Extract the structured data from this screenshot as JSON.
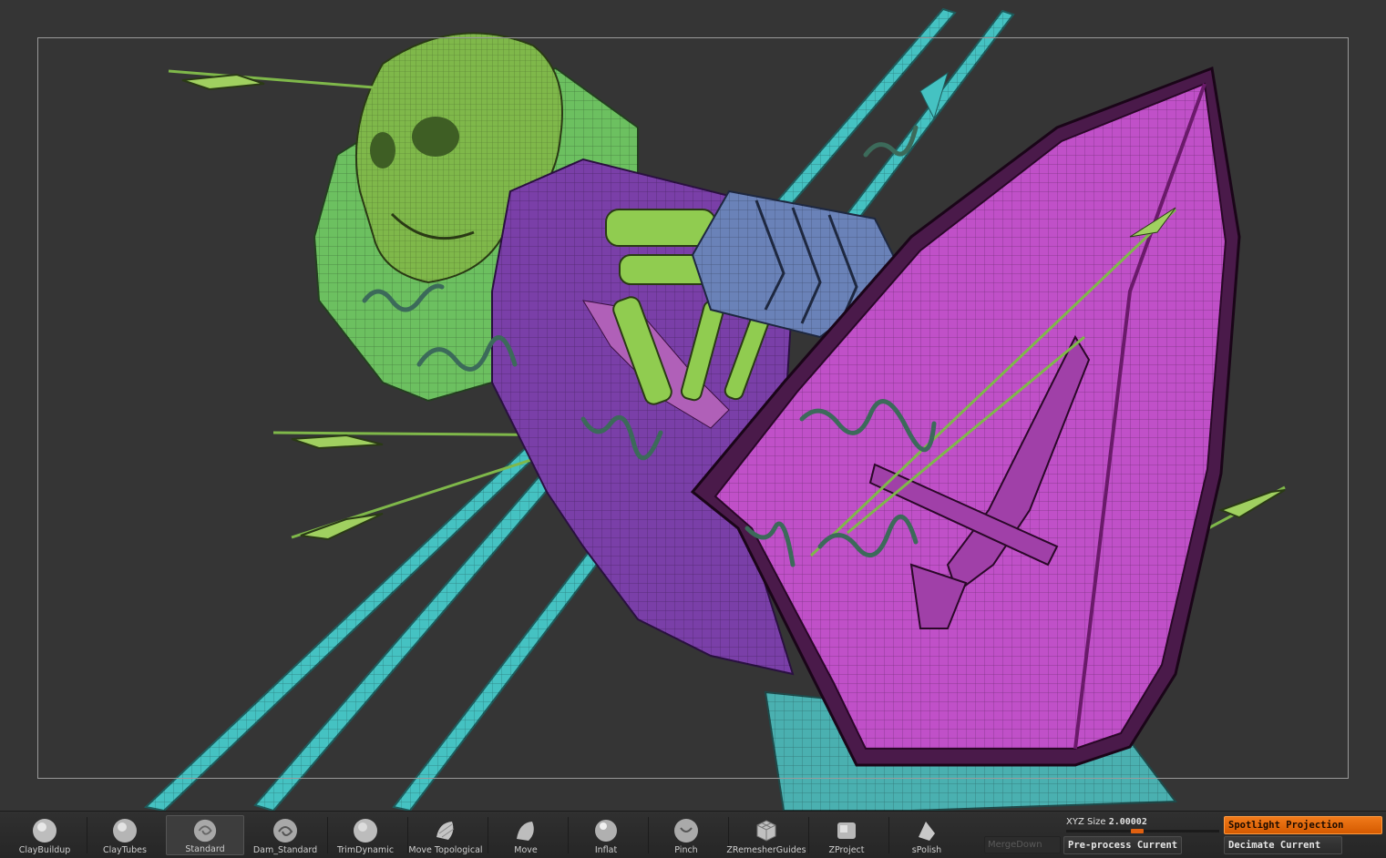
{
  "brushes": [
    {
      "label": "ClayBuildup",
      "icon": "clay-buildup-brush-icon",
      "selected": false
    },
    {
      "label": "ClayTubes",
      "icon": "clay-tubes-brush-icon",
      "selected": false
    },
    {
      "label": "Standard",
      "icon": "standard-brush-icon",
      "selected": true
    },
    {
      "label": "Dam_Standard",
      "icon": "dam-standard-brush-icon",
      "selected": false
    },
    {
      "label": "TrimDynamic",
      "icon": "trim-dynamic-brush-icon",
      "selected": false
    },
    {
      "label": "Move Topological",
      "icon": "move-topological-brush-icon",
      "selected": false
    },
    {
      "label": "Move",
      "icon": "move-brush-icon",
      "selected": false
    },
    {
      "label": "Inflat",
      "icon": "inflat-brush-icon",
      "selected": false
    },
    {
      "label": "Pinch",
      "icon": "pinch-brush-icon",
      "selected": false
    },
    {
      "label": "ZRemesherGuides",
      "icon": "zremesher-guides-brush-icon",
      "selected": false
    },
    {
      "label": "ZProject",
      "icon": "zproject-brush-icon",
      "selected": false
    },
    {
      "label": "sPolish",
      "icon": "spolish-brush-icon",
      "selected": false
    }
  ],
  "controls": {
    "merge_down": "MergeDown",
    "xyz_size_label": "XYZ Size",
    "xyz_size_value": "2.00002",
    "preprocess": "Pre-process Current",
    "spotlight": "Spotlight Projection",
    "decimate": "Decimate Current"
  },
  "colors": {
    "viewport_bg": "#353535",
    "skull_green": "#7fc24a",
    "armor_purple": "#7a3fa8",
    "shield_magenta": "#c050c8",
    "spear_cyan": "#45c2c2",
    "pauldron_blue": "#6a82b8",
    "accent_orange": "#e8701a"
  }
}
